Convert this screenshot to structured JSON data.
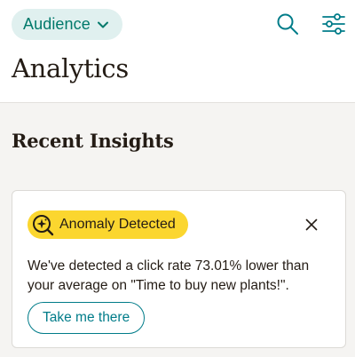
{
  "header": {
    "audience_button": {
      "label": "Audience",
      "icon": "chevron-down-icon"
    },
    "search_icon": "search-icon",
    "filter_icon": "sliders-icon",
    "title": "Analytics"
  },
  "main": {
    "section_title": "Recent Insights",
    "insight_card": {
      "badge_icon": "anomaly-search-icon",
      "badge_label": "Anomaly Detected",
      "close_icon": "close-icon",
      "message": "We've detected a click rate 73.01% lower than your average on \"Time to buy new plants!\".",
      "cta_label": "Take me there"
    }
  },
  "colors": {
    "accent": "#007c89",
    "audience_bg": "#e0f0ef",
    "badge_yellow": "#fbd62f",
    "text_dark": "#241c15",
    "page_bg": "#f5f4f2"
  }
}
